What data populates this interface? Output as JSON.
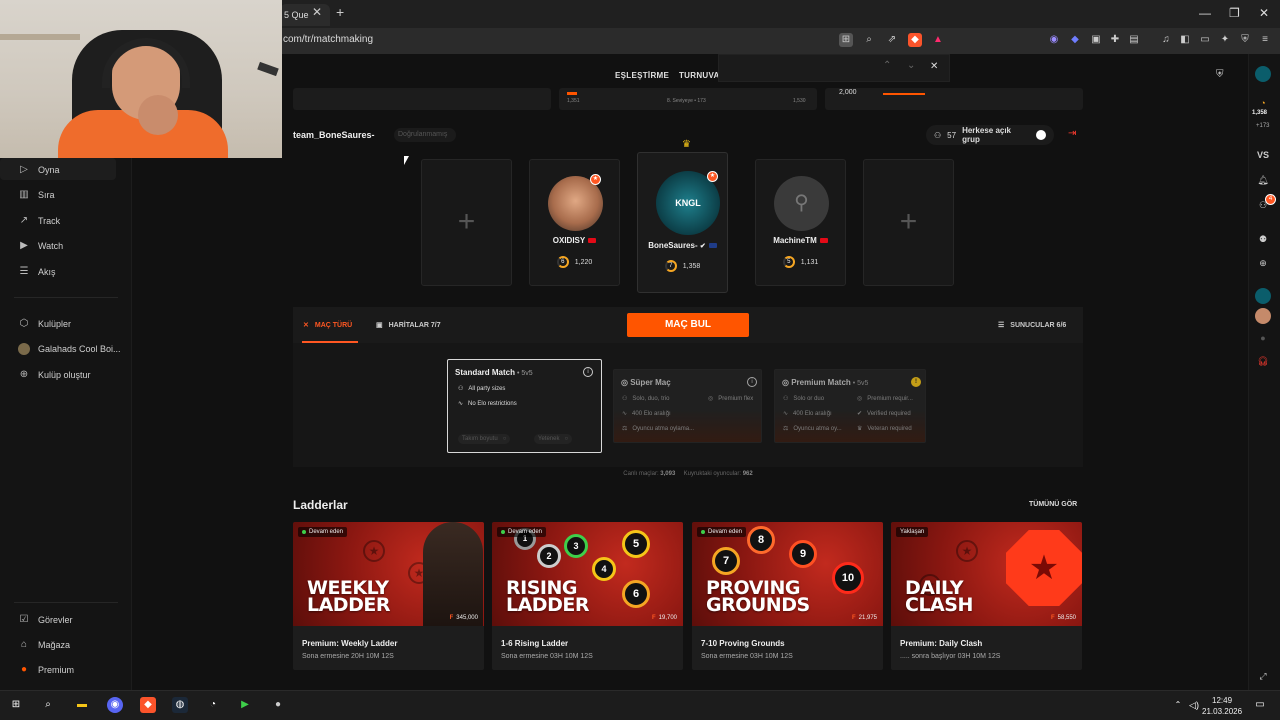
{
  "browser": {
    "tab_title": "5 Que",
    "url": "com/tr/matchmaking",
    "window_controls": [
      "—",
      "❐",
      "✕"
    ]
  },
  "app_nav": {
    "links": [
      "EŞLEŞTİRME",
      "TURNUVA"
    ]
  },
  "sidebar": {
    "items": [
      {
        "label": "Oyna",
        "icon": "play-icon"
      },
      {
        "label": "Sıra",
        "icon": "bar-chart-icon"
      },
      {
        "label": "Track",
        "icon": "trend-icon"
      },
      {
        "label": "Watch",
        "icon": "video-icon"
      },
      {
        "label": "Akış",
        "icon": "feed-icon"
      }
    ],
    "clubs": [
      {
        "label": "Kulüpler",
        "icon": "clubs-icon"
      },
      {
        "label": "Galahads Cool Boi...",
        "icon": "club-avatar"
      },
      {
        "label": "Kulüp oluştur",
        "icon": "plus-circle-icon"
      }
    ],
    "bottom": [
      {
        "label": "Görevler",
        "icon": "missions-icon"
      },
      {
        "label": "Mağaza",
        "icon": "shop-icon"
      },
      {
        "label": "Premium",
        "icon": "premium-icon"
      }
    ]
  },
  "right_sidebar": {
    "elo": "1,358",
    "elo_delta": "+173",
    "vs": "VS",
    "notif_count": "4"
  },
  "stats_strip": {
    "left_a": "1,351",
    "level_text": "8. Seviyeye • 173",
    "left_b": "1,530",
    "right_value": "2,000"
  },
  "party": {
    "team_name": "team_BoneSaures-",
    "verify_label": "Doğrulanmamış",
    "member_count": "57",
    "open_group_label": "Herkese açık grup",
    "slots": [
      {
        "type": "empty"
      },
      {
        "type": "player",
        "name": "OXIDISY",
        "level": "6",
        "elo": "1,220"
      },
      {
        "type": "leader",
        "name": "BoneSaures-",
        "level": "7",
        "elo": "1,358",
        "avatar_text": "KNGL"
      },
      {
        "type": "player",
        "name": "MachineTM",
        "level": "5",
        "elo": "1,131"
      },
      {
        "type": "empty"
      }
    ]
  },
  "match": {
    "tabs": [
      {
        "label": "MAÇ TÜRÜ",
        "icon": "crosshair-icon",
        "active": true
      },
      {
        "label": "HARİTALAR 7/7",
        "icon": "map-icon",
        "active": false
      }
    ],
    "find_button": "MAÇ BUL",
    "servers_label": "SUNUCULAR 6/6",
    "modes": [
      {
        "title": "Standard Match",
        "suffix": " • 5v5",
        "lines": [
          "All party sizes",
          "No Elo restrictions"
        ],
        "footer": [
          "Takım boyutu",
          "Yetenek"
        ]
      },
      {
        "title": "Süper Maç",
        "suffix": "",
        "lines": [
          "Solo, duo, trio",
          "400 Elo aralığı",
          "Oyuncu atma oylama..."
        ],
        "right_lines": [
          "Premium flex"
        ]
      },
      {
        "title": "Premium Match",
        "suffix": " • 5v5",
        "lines": [
          "Solo or duo",
          "400 Elo aralığı",
          "Oyuncu atma oy..."
        ],
        "right_lines": [
          "Premium requir...",
          "Verified required",
          "Veteran required"
        ]
      }
    ],
    "live_matches_label": "Canlı maçlar:",
    "live_matches": "3,093",
    "queue_players_label": "Kuyruktaki oyuncular:",
    "queue_players": "962"
  },
  "ladders": {
    "title": "Ladderlar",
    "see_all": "TÜMÜNÜ GÖR",
    "cards": [
      {
        "status": "Devam eden",
        "big": [
          "WEEKLY",
          "LADDER"
        ],
        "prize": "345,000",
        "name": "Premium: Weekly Ladder",
        "sub": "Sona ermesine 20H 10M 12S",
        "live": true
      },
      {
        "status": "Devam eden",
        "big": [
          "RISING",
          "LADDER"
        ],
        "prize": "19,700",
        "name": "1-6 Rising Ladder",
        "sub": "Sona ermesine 03H 10M 12S",
        "live": true
      },
      {
        "status": "Devam eden",
        "big": [
          "PROVING",
          "GROUNDS"
        ],
        "prize": "21,975",
        "name": "7-10 Proving Grounds",
        "sub": "Sona ermesine 03H 10M 12S",
        "live": true
      },
      {
        "status": "Yaklaşan",
        "big": [
          "DAILY",
          "CLASH"
        ],
        "prize": "58,550",
        "name": "Premium: Daily Clash",
        "sub": "..... sonra başlıyor 03H 10M 12S",
        "live": false
      }
    ]
  },
  "taskbar": {
    "time": "12:49",
    "date": "21.03.2026"
  },
  "colors": {
    "accent": "#ff5500",
    "level_ring": "#f5a623",
    "live_dot": "#3ecf4a"
  }
}
